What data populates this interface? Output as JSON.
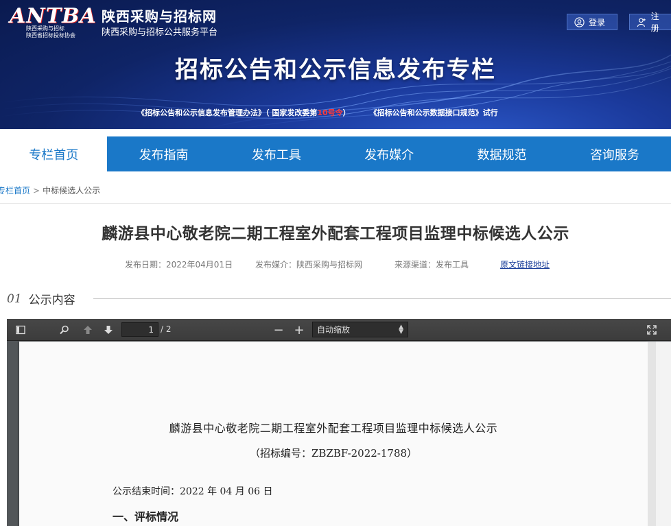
{
  "header": {
    "logo_mark": "ANTBA",
    "logo_line1": "陕西采购与招标",
    "logo_line2": "陕西省招标投标协会",
    "site_name": "陕西采购与招标网",
    "site_subtitle": "陕西采购与招标公共服务平台",
    "login_label": "登录",
    "register_label": "注册",
    "banner_title": "招标公告和公示信息发布专栏",
    "link1_prefix": "《招标公告和公示信息发布管理办法》（ 国家发改委第",
    "link1_red": "10号令",
    "link1_suffix": "）",
    "link2": "《招标公告和公示数据接口规范》试行"
  },
  "nav": {
    "items": [
      {
        "label": "专栏首页"
      },
      {
        "label": "发布指南"
      },
      {
        "label": "发布工具"
      },
      {
        "label": "发布媒介"
      },
      {
        "label": "数据规范"
      },
      {
        "label": "咨询服务"
      }
    ]
  },
  "breadcrumb": {
    "home": "专栏首页",
    "separator": ">",
    "current": "中标候选人公示"
  },
  "article": {
    "title": "麟游县中心敬老院二期工程室外配套工程项目监理中标候选人公示",
    "date": "发布日期：2022年04月01日",
    "media": "发布媒介：陕西采购与招标网",
    "source": "来源渠道：发布工具",
    "original_link": "原文链接地址"
  },
  "section": {
    "number": "01",
    "label": "公示内容"
  },
  "pdf_viewer": {
    "page_current": "1",
    "page_total": "/ 2",
    "zoom": "自动缩放",
    "zoom_out": "−",
    "zoom_in": "+",
    "doc_title": "麟游县中心敬老院二期工程室外配套工程项目监理中标候选人公示",
    "doc_number": "（招标编号：ZBZBF-2022-1788）",
    "doc_end_time": "公示结束时间：2022 年 04 月 06 日",
    "doc_section1": "一、评标情况"
  },
  "colors": {
    "nav_blue": "#1a78c8",
    "banner_dark": "#0f2466",
    "link_red": "#ff3b3b"
  }
}
